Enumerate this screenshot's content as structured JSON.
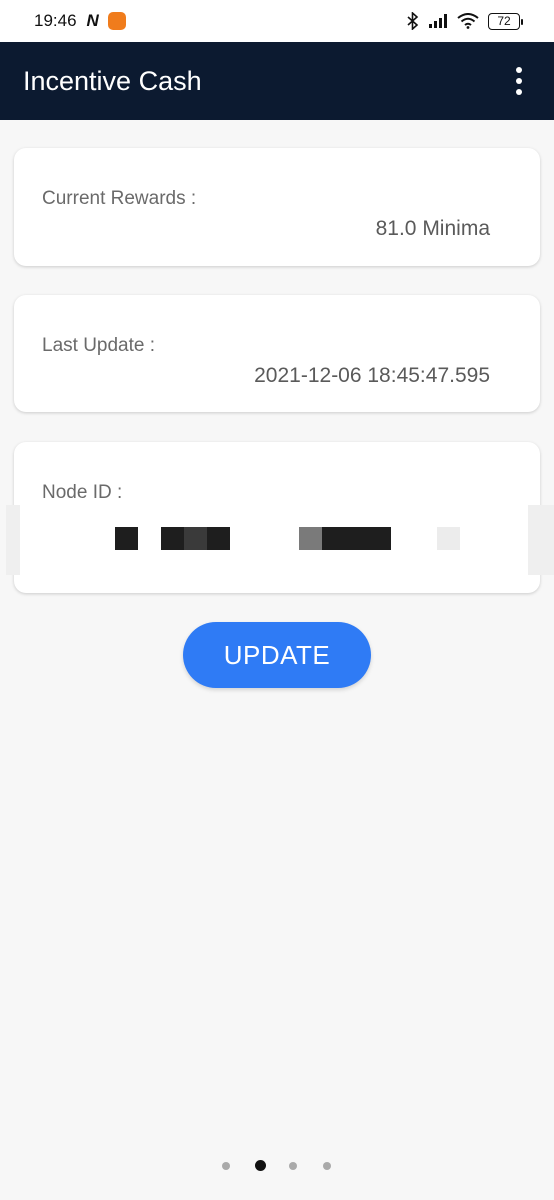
{
  "status_bar": {
    "time": "19:46",
    "battery": "72"
  },
  "app_bar": {
    "title": "Incentive Cash"
  },
  "cards": {
    "rewards": {
      "label": "Current Rewards :",
      "value": "81.0 Minima"
    },
    "last_update": {
      "label": "Last Update :",
      "value": "2021-12-06 18:45:47.595"
    },
    "node_id": {
      "label": "Node ID :"
    }
  },
  "actions": {
    "update_label": "UPDATE"
  },
  "pager": {
    "page_count": 4,
    "active_page": 2
  },
  "colors": {
    "app_bar": "#0c1a30",
    "accent_button": "#2f7bf5",
    "background": "#f7f7f7"
  }
}
